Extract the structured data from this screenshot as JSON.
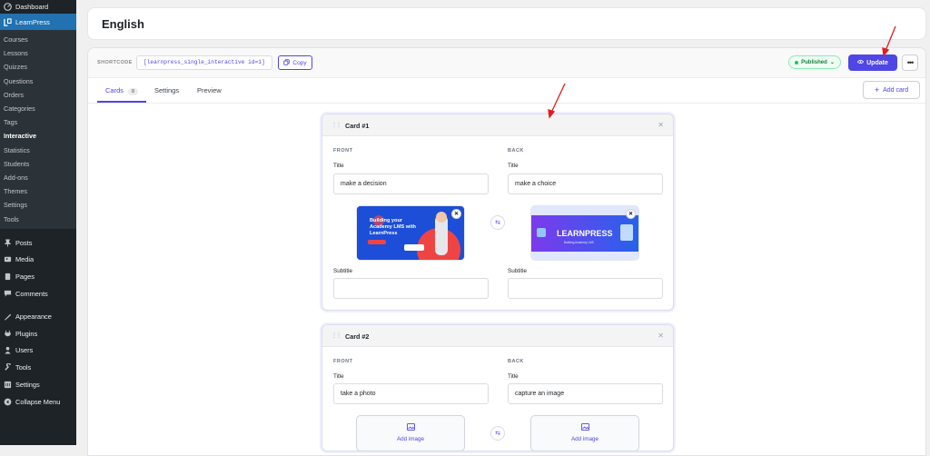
{
  "sidebar": {
    "dashboard": "Dashboard",
    "learnpress": "LearnPress",
    "submenu": [
      "Courses",
      "Lessons",
      "Quizzes",
      "Questions",
      "Orders",
      "Categories",
      "Tags",
      "Interactive",
      "Statistics",
      "Students",
      "Add-ons",
      "Themes",
      "Settings",
      "Tools"
    ],
    "current_submenu": "Interactive",
    "main": [
      {
        "label": "Posts",
        "icon": "pin-icon"
      },
      {
        "label": "Media",
        "icon": "media-icon"
      },
      {
        "label": "Pages",
        "icon": "pages-icon"
      },
      {
        "label": "Comments",
        "icon": "comments-icon"
      }
    ],
    "main2": [
      {
        "label": "Appearance",
        "icon": "appearance-icon"
      },
      {
        "label": "Plugins",
        "icon": "plugins-icon"
      },
      {
        "label": "Users",
        "icon": "users-icon"
      },
      {
        "label": "Tools",
        "icon": "tools-icon"
      },
      {
        "label": "Settings",
        "icon": "settings-icon"
      },
      {
        "label": "Collapse Menu",
        "icon": "collapse-icon"
      }
    ]
  },
  "page": {
    "title": "English"
  },
  "toolbar": {
    "shortcode_label": "SHORTCODE",
    "shortcode": "[learnpress_single_interactive id=1]",
    "copy_label": "Copy",
    "status_label": "Published",
    "update_label": "Update",
    "more_label": "•••"
  },
  "tabs": {
    "cards_label": "Cards",
    "cards_count": "8",
    "settings_label": "Settings",
    "preview_label": "Preview",
    "add_card_label": "Add card"
  },
  "cards": [
    {
      "title": "Card #1",
      "front_label": "FRONT",
      "back_label": "BACK",
      "front_title_label": "Title",
      "front_title": "make a decision",
      "back_title_label": "Title",
      "back_title": "make a choice",
      "front_subtitle_label": "Subtitle",
      "back_subtitle_label": "Subtitle",
      "front_image_text": "Building your Academy LMS with LearnPress",
      "back_image_text": "LEARNPRESS"
    },
    {
      "title": "Card #2",
      "front_label": "FRONT",
      "back_label": "BACK",
      "front_title_label": "Title",
      "front_title": "take a photo",
      "back_title_label": "Title",
      "back_title": "capture an image",
      "add_image_label": "Add image"
    }
  ],
  "colors": {
    "accent": "#4f46e5",
    "sidebar_bg": "#1d2327",
    "sidebar_active": "#2271b1",
    "published": "#15803d",
    "annotation_arrow": "#e11d1d"
  }
}
